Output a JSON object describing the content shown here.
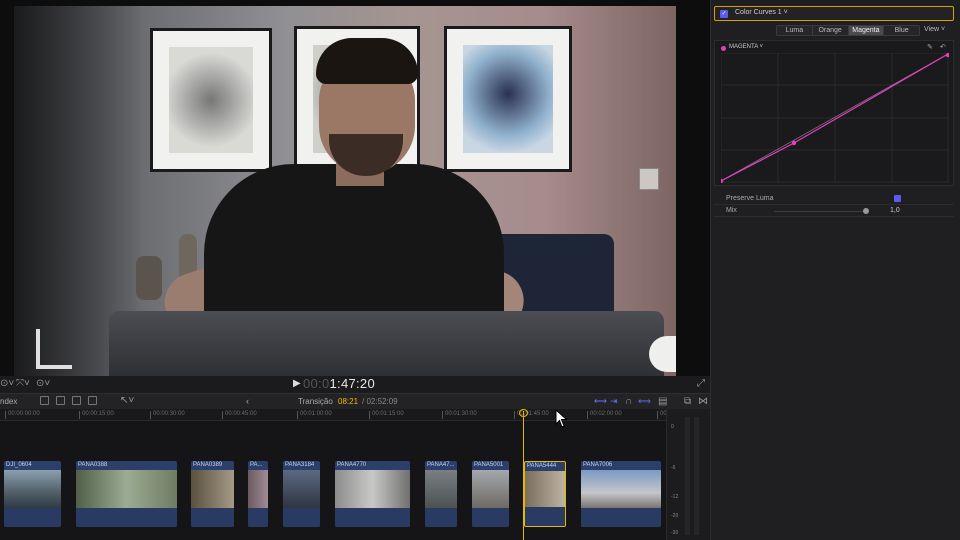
{
  "viewer": {
    "timecode_dim": "00:0",
    "timecode_main": "1:47:20",
    "play_icon": "▶"
  },
  "timeline": {
    "index_label": "ndex",
    "back_arrow": "‹",
    "transition_label": "Transição",
    "current_time": "08:21",
    "total_time": "/ 02:52:09",
    "ruler": [
      "00:00:00:00",
      "00:00:15:00",
      "00:00:30:00",
      "00:00:45:00",
      "00:01:00:00",
      "00:01:15:00",
      "00:01:30:00",
      "00:01:45:00",
      "00:02:00:00",
      "00:02:15:00"
    ],
    "clips": [
      {
        "name": "DJI_0604"
      },
      {
        "name": "PANA0388"
      },
      {
        "name": "PANA0389"
      },
      {
        "name": "PA..."
      },
      {
        "name": "PANA3184"
      },
      {
        "name": "PANA4770"
      },
      {
        "name": "PANA47..."
      },
      {
        "name": "PANA5001"
      },
      {
        "name": "PANA5444"
      },
      {
        "name": "PANA7006"
      }
    ],
    "meter_labels": [
      "0",
      "-6",
      "-12",
      "-20",
      "-30"
    ]
  },
  "inspector": {
    "effect_name": "Color Curves 1 ˅",
    "effect_check": "✓",
    "tabs": [
      "Luma",
      "Orange",
      "Magenta",
      "Blue"
    ],
    "active_tab": "Magenta",
    "view_menu": "View ˅",
    "channel_label": "MAGENTA ˅",
    "preserve_luma_label": "Preserve Luma",
    "mix_label": "Mix",
    "mix_value": "1,0",
    "curve_color": "#e040c0"
  }
}
